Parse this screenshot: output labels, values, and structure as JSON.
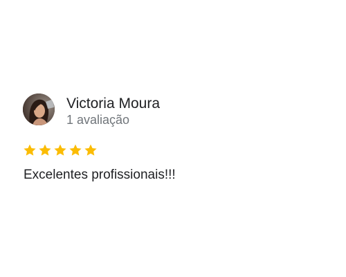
{
  "review": {
    "reviewer_name": "Victoria Moura",
    "review_count": "1 avaliação",
    "rating": 5,
    "rating_max": 5,
    "text": "Excelentes profissionais!!!"
  },
  "colors": {
    "star": "#fbbc04",
    "name": "#202124",
    "meta": "#70757a"
  },
  "icons": {
    "avatar": "profile-photo",
    "star": "star-icon"
  }
}
